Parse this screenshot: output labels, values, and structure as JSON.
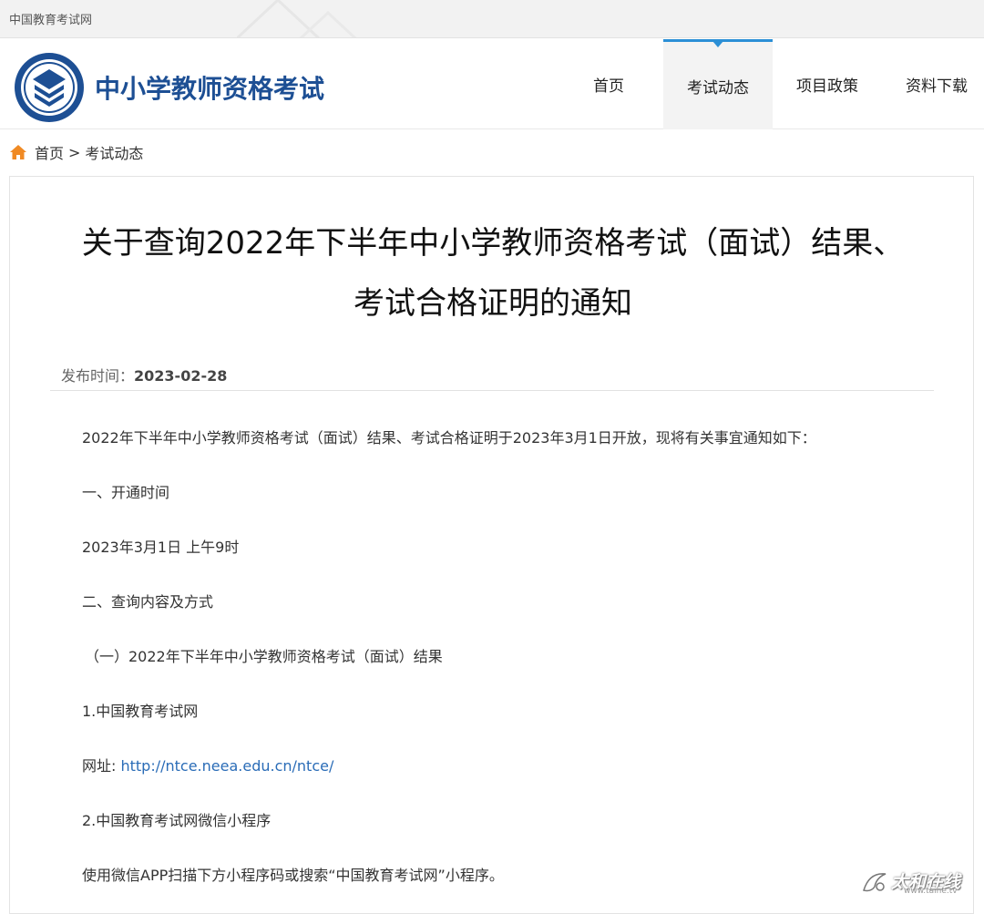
{
  "topbar": {
    "site_name": "中国教育考试网"
  },
  "header": {
    "brand_title": "中小学教师资格考试",
    "nav": [
      {
        "label": "首页",
        "active": false
      },
      {
        "label": "考试动态",
        "active": true
      },
      {
        "label": "项目政策",
        "active": false
      },
      {
        "label": "资料下载",
        "active": false
      }
    ]
  },
  "breadcrumb": {
    "home": "首页",
    "separator": ">",
    "current": "考试动态"
  },
  "article": {
    "title_line1": "关于查询2022年下半年中小学教师资格考试（面试）结果、",
    "title_line2": "考试合格证明的通知",
    "publish_label": "发布时间：",
    "publish_date": "2023-02-28",
    "paragraphs": [
      "2022年下半年中小学教师资格考试（面试）结果、考试合格证明于2023年3月1日开放，现将有关事宜通知如下：",
      "一、开通时间",
      "2023年3月1日 上午9时",
      "二、查询内容及方式",
      "（一）2022年下半年中小学教师资格考试（面试）结果",
      "1.中国教育考试网",
      "2.中国教育考试网微信小程序",
      "使用微信APP扫描下方小程序码或搜索“中国教育考试网”小程序。"
    ],
    "url_label": "网址: ",
    "url": "http://ntce.neea.edu.cn/ntce/"
  },
  "watermark": {
    "text": "太和在线",
    "url": "www.taihe.tv"
  },
  "colors": {
    "brand": "#1d4f94",
    "accent": "#2b8fd6",
    "link": "#2a6cb7",
    "home_icon": "#f08a24"
  },
  "icons": {
    "home": "home-icon",
    "logo": "teacher-qualification-emblem"
  }
}
